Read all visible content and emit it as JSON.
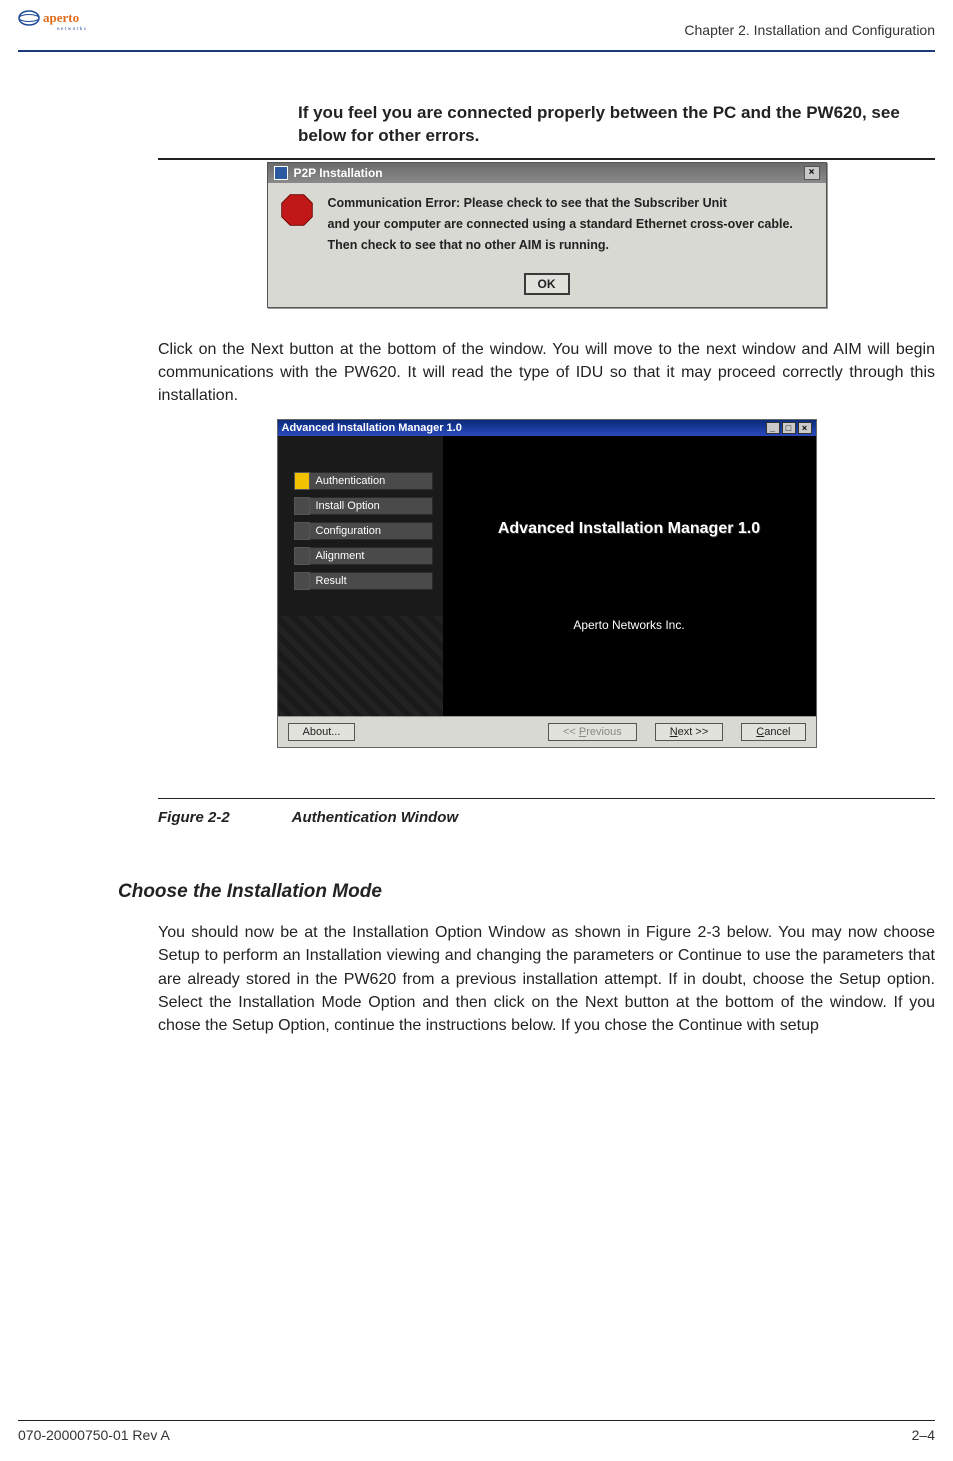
{
  "header": {
    "chapter": "Chapter 2.  Installation and Configuration",
    "logo_text_main": "aperto",
    "logo_text_sub": "n e t w o r k s"
  },
  "lead_bold": "If you feel you are connected properly between the PC and the PW620, see below for other errors.",
  "dialog1": {
    "title": "P2P Installation",
    "line1": "Communication Error: Please check to see that the Subscriber Unit",
    "line2": "and your computer are connected using a standard Ethernet cross-over cable.",
    "line3": "Then check to see that no other AIM is running.",
    "ok": "OK",
    "close_x": "×"
  },
  "para1": "Click on the Next button at the bottom of the window. You will move to the next window and AIM will begin communications with the PW620. It will read the type of IDU so that it may proceed correctly through this installation.",
  "aim": {
    "title": "Advanced Installation Manager 1.0",
    "main_title": "Advanced Installation Manager 1.0",
    "company": "Aperto Networks Inc.",
    "steps": [
      {
        "label": "Authentication",
        "active": true
      },
      {
        "label": "Install Option",
        "active": false
      },
      {
        "label": "Configuration",
        "active": false
      },
      {
        "label": "Alignment",
        "active": false
      },
      {
        "label": "Result",
        "active": false
      }
    ],
    "buttons": {
      "about": "About...",
      "previous_prefix": "<< ",
      "previous_u": "P",
      "previous_rest": "revious",
      "next_u": "N",
      "next_rest": "ext >>",
      "cancel_u": "C",
      "cancel_rest": "ancel"
    },
    "win_min": "_",
    "win_max": "□",
    "win_close": "×"
  },
  "figure": {
    "num": "Figure 2-2",
    "title": "Authentication Window"
  },
  "section": {
    "heading": "Choose the Installation Mode",
    "para": "You should now be at the Installation Option Window as shown in Figure 2-3 below. You may now choose Setup to perform an Installation viewing and changing the parameters or Continue to use the parameters that are already stored in the PW620 from a previous installation attempt. If in doubt, choose the Setup option. Select the Installation Mode Option and then click on the Next button at the bottom of the window. If you chose the Setup Option, continue the instructions below. If you chose the Continue with setup"
  },
  "footer": {
    "doc": "070-20000750-01 Rev A",
    "page": "2–4"
  }
}
